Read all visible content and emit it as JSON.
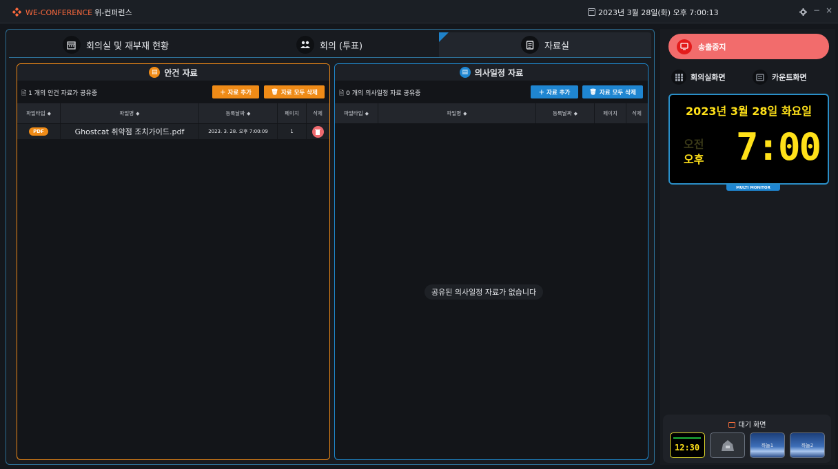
{
  "titlebar": {
    "app_name": "WE-CONFERENCE",
    "app_subtitle": "위-컨퍼런스",
    "datetime": "2023년 3월 28일(화) 오후 7:00:13",
    "minimize": "−",
    "close": "×"
  },
  "tabs": [
    {
      "label": "회의실 및 재부재 현황",
      "icon": "calendar-icon"
    },
    {
      "label": "회의 (투표)",
      "icon": "people-icon"
    },
    {
      "label": "자료실",
      "icon": "document-icon",
      "active": true
    }
  ],
  "agenda": {
    "title": "안건 자료",
    "share_count": "1 개의 안건 자료가 공유중",
    "add_button": "＋  자료 추가",
    "delete_all_button": "자료 모두 삭제",
    "columns": [
      "파일타입",
      "파일명",
      "등록날짜",
      "페이지",
      "삭제"
    ],
    "rows": [
      {
        "type": "PDF",
        "filename": "Ghostcat 취약점 조치가이드.pdf",
        "date": "2023. 3. 28. 오후 7:00:09",
        "pages": "1"
      }
    ]
  },
  "schedule": {
    "title": "의사일정 자료",
    "share_count": "0 개의 의사일정 자료 공유중",
    "add_button": "＋  자료 추가",
    "delete_all_button": "자료 모두 삭제",
    "columns": [
      "파일타입",
      "파일명",
      "등록날짜",
      "페이지",
      "삭제"
    ],
    "empty_message": "공유된 의사일정 자료가 없습니다"
  },
  "side": {
    "stop_button": "송출중지",
    "room_view_button": "회의실화면",
    "countdown_button": "카운트화면",
    "monitor": {
      "date": "2023년 3월 28일 화요일",
      "am": "오전",
      "pm": "오후",
      "time": "7:00",
      "label": "MULTI MONITOR"
    },
    "standby": {
      "title": "대기 화면",
      "thumbnails": [
        {
          "name": "clock",
          "text": "12:30",
          "selected": true
        },
        {
          "name": "logo",
          "text": ""
        },
        {
          "name": "sky1",
          "text": "하늘1"
        },
        {
          "name": "sky2",
          "text": "하늘2"
        }
      ]
    }
  },
  "colors": {
    "accent_orange": "#ef8b17",
    "accent_blue": "#1f86d1",
    "stop_red": "#f26c6c",
    "clock_yellow": "#ffe119"
  }
}
